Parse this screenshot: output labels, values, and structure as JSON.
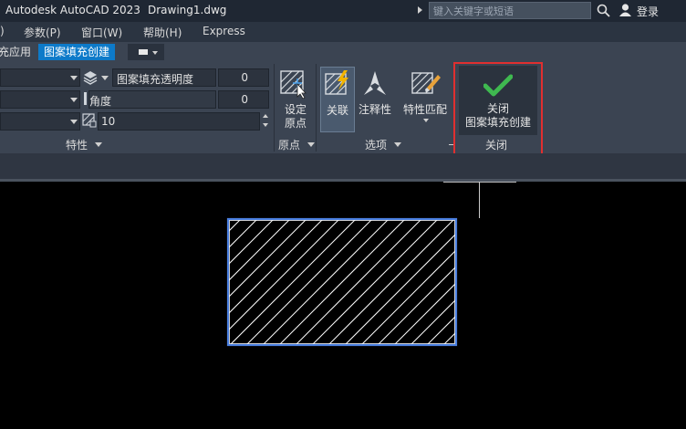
{
  "titlebar": {
    "app_title": "Autodesk AutoCAD 2023",
    "doc_title": "Drawing1.dwg",
    "search_placeholder": "键入关键字或短语",
    "login_label": "登录"
  },
  "menubar": {
    "items": [
      "参数(P)",
      "窗口(W)",
      "帮助(H)",
      "Express"
    ]
  },
  "tabs": {
    "partial_label": "充应用",
    "active_label": "图案填充创建"
  },
  "properties": {
    "transparency_label": "图案填充透明度",
    "transparency_value": "0",
    "angle_label": "角度",
    "angle_value": "0",
    "scale_value": "10",
    "panel_label": "特性"
  },
  "origin": {
    "set_origin_line1": "设定",
    "set_origin_line2": "原点",
    "panel_label": "原点"
  },
  "options": {
    "associative_label": "关联",
    "annotative_label": "注释性",
    "match_props_label": "特性匹配",
    "panel_label": "选项"
  },
  "close": {
    "line1": "关闭",
    "line2": "图案填充创建",
    "panel_label": "关闭"
  },
  "colors": {
    "accent": "#0d7ac9",
    "highlight": "#e02f2f",
    "check": "#3fb950",
    "hatch_outline": "#4a7fe0"
  }
}
